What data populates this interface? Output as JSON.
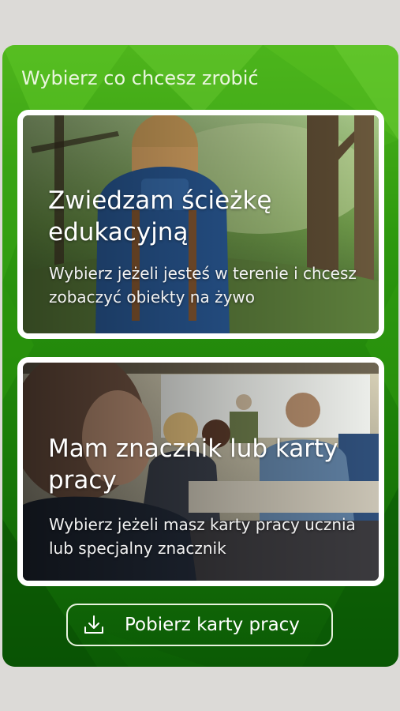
{
  "screen": {
    "heading": "Wybierz co chcesz zrobić"
  },
  "options": [
    {
      "title": "Zwiedzam ścieżkę edukacyjną",
      "description": "Wybierz jeżeli jesteś w terenie i chcesz zobaczyć obiekty na żywo"
    },
    {
      "title": "Mam znacznik lub karty pracy",
      "description": "Wybierz jeżeli masz karty pracy ucznia lub specjalny znacznik"
    }
  ],
  "download": {
    "label": "Pobierz karty pracy",
    "icon": "download-icon"
  },
  "colors": {
    "panel_green": "#2e9a0f",
    "card_border": "#ffffff",
    "page_background": "#dcdad7"
  }
}
